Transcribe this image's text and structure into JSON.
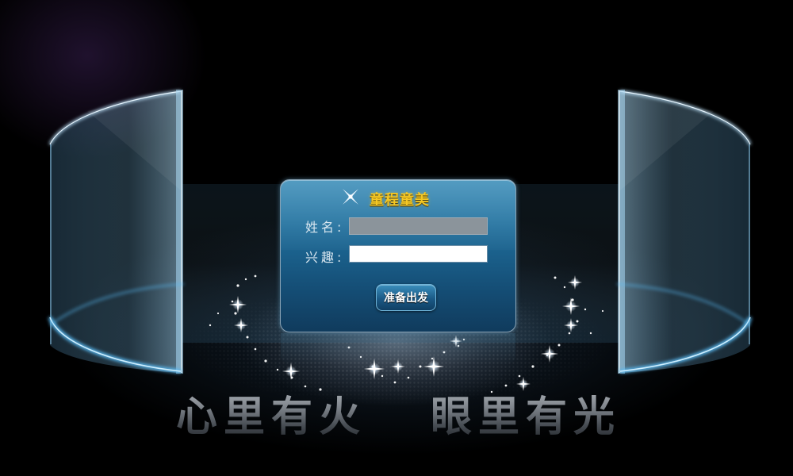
{
  "panel": {
    "title": "童程童美",
    "name_label": "姓名:",
    "interest_label": "兴趣:",
    "name_value": "",
    "interest_value": "",
    "submit_label": "准备出发"
  },
  "slogans": {
    "left": "心里有火",
    "right": "眼里有光"
  },
  "colors": {
    "background": "#000000",
    "panel": "#1f6f9d",
    "title": "#f5c824",
    "glass": "#7ec8ff"
  },
  "icons": {
    "sparkle": "sparkle-icon"
  }
}
